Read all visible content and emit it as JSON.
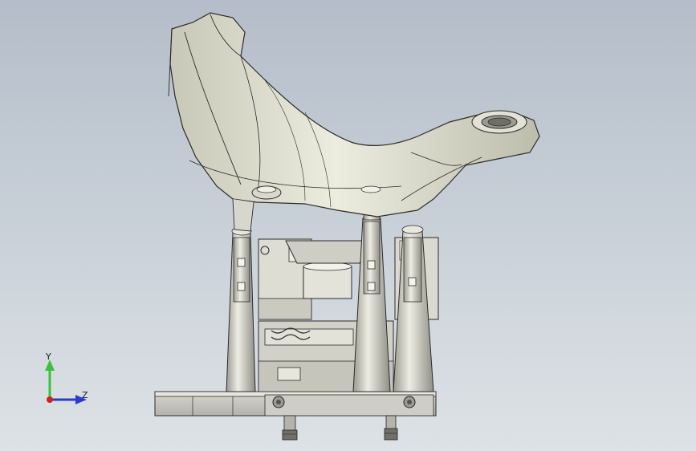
{
  "viewport": {
    "background_top": "#b4bdc9",
    "background_bottom": "#dde2e6"
  },
  "model": {
    "casting_color": "#dcdccd",
    "metal_color": "#c9c8be",
    "edge_color": "#2b2b2b"
  },
  "triad": {
    "y_label": "Y",
    "z_label": "Z",
    "y_color": "#3fbf3f",
    "z_color": "#2a3ccf",
    "x_color": "#d22020"
  }
}
